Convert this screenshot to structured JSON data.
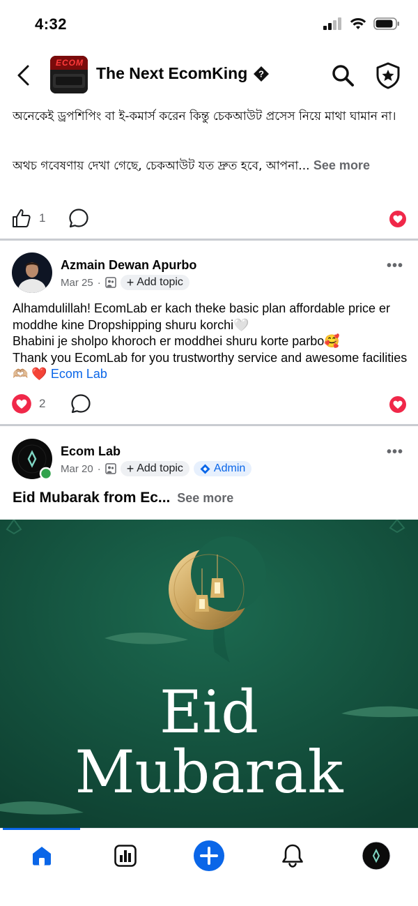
{
  "status_bar": {
    "time": "4:32"
  },
  "header": {
    "group_name": "The Next EcomKing",
    "avatar_text": "ECOM"
  },
  "post1": {
    "line1": "অনেকেই ড্রপশিপিং বা ই-কমার্স করেন কিন্তু চেকআউট প্রসেস নিয়ে মাথা ঘামান না।",
    "line2": "অথচ গবেষণায় দেখা গেছে, চেকআউট যত দ্রুত হবে, আপনা...",
    "see_more": "See more",
    "like_count": "1"
  },
  "post2": {
    "author": "Azmain Dewan Apurbo",
    "date": "Mar 25",
    "separator": "·",
    "add_topic": "Add topic",
    "body_lines": [
      "Alhamdulillah! EcomLab er kach theke basic plan affordable price er moddhe kine Dropshipping shuru korchi🤍",
      "Bhabini je sholpo khoroch er moddhei shuru korte parbo🥰",
      "Thank you EcomLab for you trustworthy service and awesome facilities🫶🏼 ❤️"
    ],
    "mention": "Ecom Lab",
    "reaction_count": "2"
  },
  "post3": {
    "author": "Ecom Lab",
    "date": "Mar 20",
    "separator": "·",
    "add_topic": "Add topic",
    "admin_badge": "Admin",
    "title": "Eid Mubarak from Ec...",
    "see_more": "See more",
    "image_line1": "Eid",
    "image_line2": "Mubarak"
  },
  "colors": {
    "accent_blue": "#0a66e8",
    "heart_red": "#f02849",
    "image_green": "#14543f",
    "moon_gold": "#c9a15a"
  },
  "icons": {
    "back": "chevron-left-icon",
    "verified": "diamond-question-icon",
    "search": "search-icon",
    "badge": "shield-star-icon",
    "like": "thumbs-up-icon",
    "comment": "comment-bubble-icon",
    "love": "heart-icon",
    "nav": [
      "home-icon",
      "insights-icon",
      "create-plus-icon",
      "notifications-bell-icon",
      "profile-avatar-icon"
    ]
  }
}
